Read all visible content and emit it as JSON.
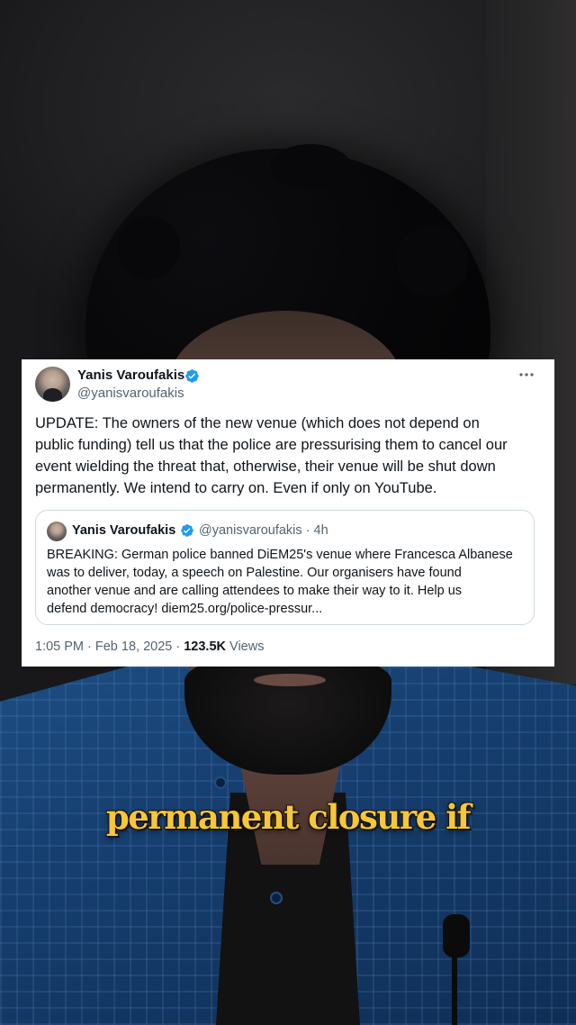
{
  "tweet": {
    "author_name": "Yanis Varoufakis",
    "author_handle": "@yanisvaroufakis",
    "text": "UPDATE: The owners of the new venue (which does not depend on\npublic funding) tell us that the police are pressurising them to cancel our\nevent wielding the threat that, otherwise, their venue will be shut down\npermanently. We intend to carry on. Even if only on YouTube.",
    "timestamp": "1:05 PM · Feb 18, 2025 · ",
    "views_count": "123.5K",
    "views_label": " Views"
  },
  "quoted_tweet": {
    "author_name": "Yanis Varoufakis",
    "meta": "@yanisvaroufakis · 4h",
    "text": "BREAKING: German police banned DiEM25's venue where Francesca Albanese\nwas to deliver, today, a speech on Palestine. Our organisers have found\nanother venue and are calling attendees to make their way to it. Help us\ndefend democracy! diem25.org/police-pressur..."
  },
  "caption": {
    "text": "permanent closure if"
  },
  "icons": {
    "verified": "verified-badge-icon",
    "more": "more-options-icon"
  },
  "colors": {
    "verified_blue": "#1d9bf0",
    "caption_yellow": "#f6c73a",
    "text_primary": "#0f1419",
    "text_secondary": "#536471"
  }
}
